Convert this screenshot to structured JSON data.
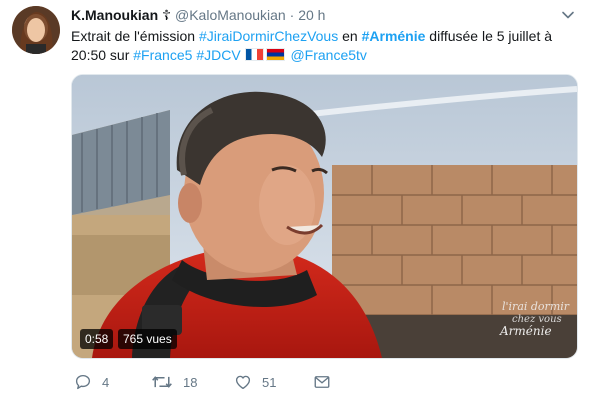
{
  "tweet": {
    "author_name": "K.Manoukian",
    "cross_symbol": "☦",
    "handle": "@KaloManoukian",
    "separator": "·",
    "time": "20 h",
    "text": {
      "part1": "Extrait de l'émission ",
      "hashtag1": "#JiraiDormirChezVous",
      "part2": " en ",
      "hashtag2": "#Arménie",
      "part3": " diffusée le 5 juillet à 20:50 sur ",
      "hashtag3": "#France5",
      "space1": " ",
      "hashtag4": "#JDCV",
      "space2": " ",
      "mention": "@France5tv"
    },
    "flags": [
      "flag-france-icon",
      "flag-armenia-icon"
    ]
  },
  "video": {
    "duration": "0:58",
    "views": "765 vues",
    "watermark_line1": "l'irai dormir",
    "watermark_line2": "chez vous",
    "watermark_line3": "Arménie"
  },
  "actions": {
    "reply_count": "4",
    "retweet_count": "18",
    "like_count": "51"
  },
  "colors": {
    "link": "#1da1f2",
    "secondary": "#657786",
    "text": "#14171a"
  }
}
